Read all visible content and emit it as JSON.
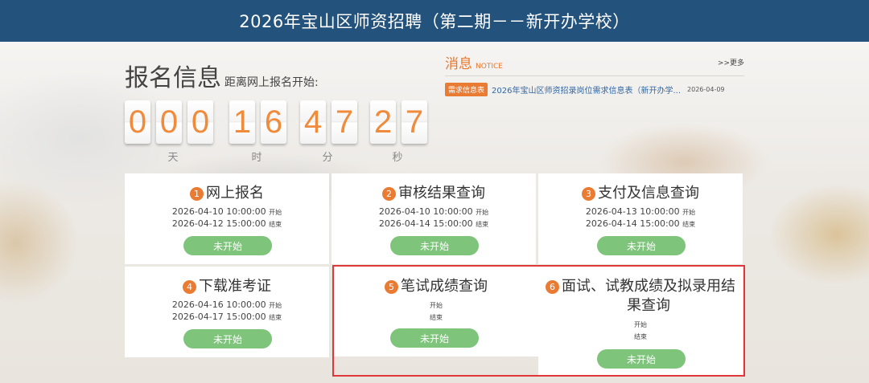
{
  "header": {
    "title": "2026年宝山区师资招聘（第二期－－新开办学校）"
  },
  "registration": {
    "title": "报名信息",
    "subtitle": "距离网上报名开始:",
    "countdown": {
      "days": [
        "0",
        "0",
        "0"
      ],
      "hours": [
        "1",
        "6"
      ],
      "minutes": [
        "4",
        "7"
      ],
      "seconds": [
        "2",
        "7"
      ],
      "unit_days": "天",
      "unit_hours": "时",
      "unit_minutes": "分",
      "unit_seconds": "秒"
    }
  },
  "notice": {
    "title": "消息",
    "title_en": "NOTICE",
    "more": ">>更多",
    "items": [
      {
        "tag": "需求信息表",
        "text": "2026年宝山区师资招录岗位需求信息表（新开办学...",
        "date": "2026-04-09"
      }
    ]
  },
  "steps": [
    {
      "num": "1",
      "title": "网上报名",
      "start": "2026-04-10 10:00:00",
      "end": "2026-04-12 15:00:00",
      "start_label": "开始",
      "end_label": "结束",
      "button": "未开始"
    },
    {
      "num": "2",
      "title": "审核结果查询",
      "start": "2026-04-10 10:00:00",
      "end": "2026-04-14 15:00:00",
      "start_label": "开始",
      "end_label": "结束",
      "button": "未开始"
    },
    {
      "num": "3",
      "title": "支付及信息查询",
      "start": "2026-04-13 10:00:00",
      "end": "2026-04-14 15:00:00",
      "start_label": "开始",
      "end_label": "结束",
      "button": "未开始"
    },
    {
      "num": "4",
      "title": "下载准考证",
      "start": "2026-04-16 10:00:00",
      "end": "2026-04-17 15:00:00",
      "start_label": "开始",
      "end_label": "结束",
      "button": "未开始"
    },
    {
      "num": "5",
      "title": "笔试成绩查询",
      "start": "",
      "end": "",
      "start_label": "开始",
      "end_label": "结束",
      "button": "未开始"
    },
    {
      "num": "6",
      "title_line1": "面试、试教成绩及拟录用结",
      "title_line2": "果查询",
      "start": "",
      "end": "",
      "start_label": "开始",
      "end_label": "结束",
      "button": "未开始"
    }
  ],
  "colors": {
    "header_bg": "#23527d",
    "accent_orange": "#ea7b33",
    "button_green": "#7ec47b",
    "highlight_red": "#e0383a",
    "link_blue": "#2f67a8"
  }
}
